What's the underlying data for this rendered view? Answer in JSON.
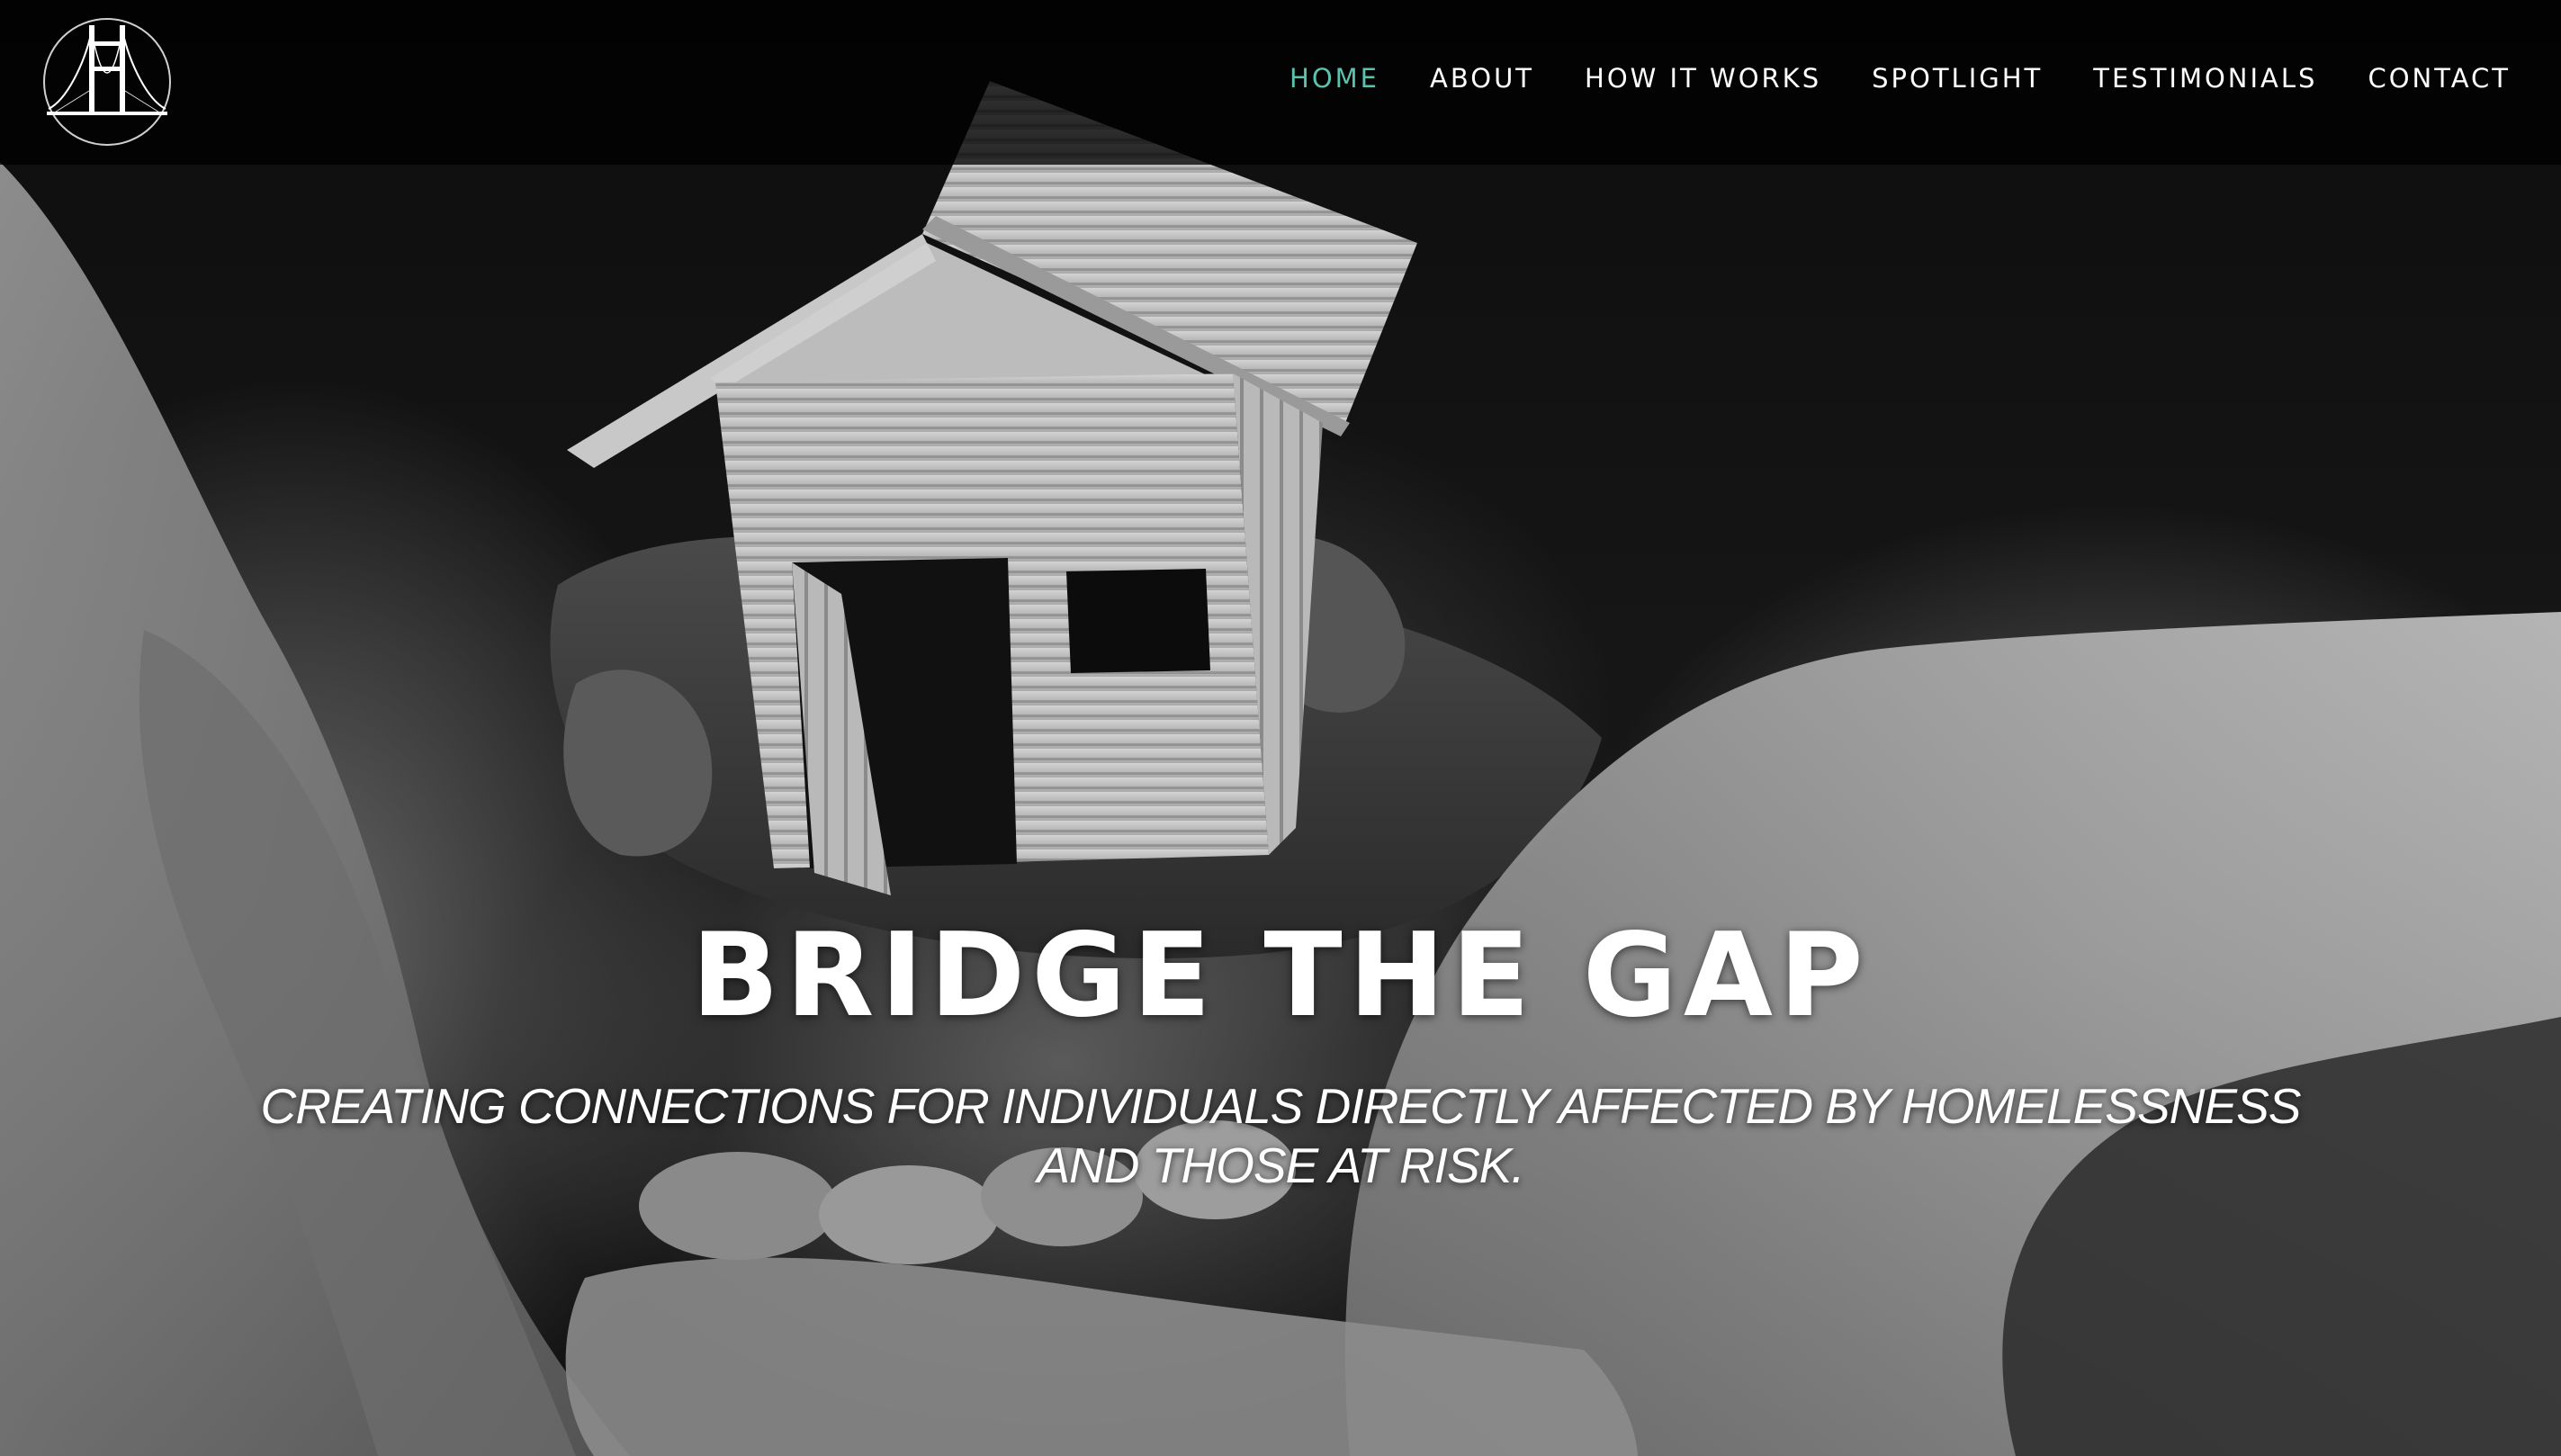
{
  "nav": {
    "items": [
      {
        "label": "HOME",
        "active": true
      },
      {
        "label": "ABOUT",
        "active": false
      },
      {
        "label": "HOW IT WORKS",
        "active": false
      },
      {
        "label": "SPOTLIGHT",
        "active": false
      },
      {
        "label": "TESTIMONIALS",
        "active": false
      },
      {
        "label": "CONTACT",
        "active": false
      }
    ]
  },
  "hero": {
    "title": "BRIDGE THE GAP",
    "subtitle_line1": "CREATING CONNECTIONS FOR INDIVIDUALS DIRECTLY AFFECTED BY HOMELESSNESS",
    "subtitle_line2": "AND THOSE AT RISK.",
    "image_description_icon": "hands-holding-cardboard-house"
  },
  "colors": {
    "accent": "#5bc2ad",
    "navbar_bg": "#000000",
    "text": "#ffffff"
  },
  "logo": {
    "icon": "golden-gate-bridge-icon"
  }
}
